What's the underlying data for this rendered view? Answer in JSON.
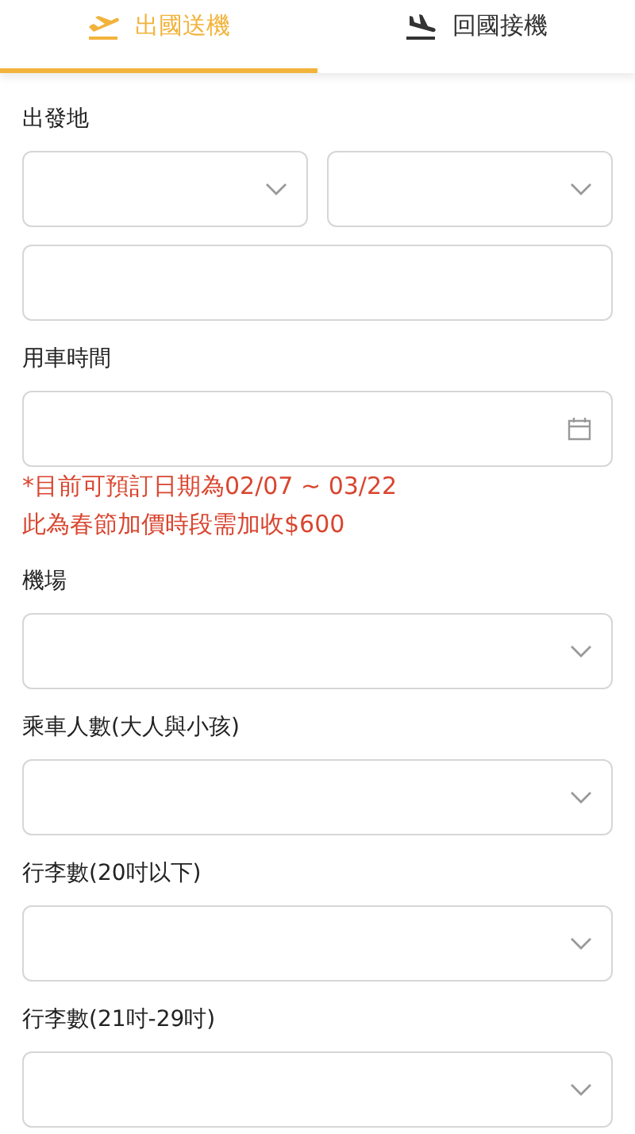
{
  "tabs": [
    {
      "label": "出國送機",
      "kind": "departure",
      "selected": true
    },
    {
      "label": "回國接機",
      "kind": "arrival",
      "selected": false
    }
  ],
  "form": [
    {
      "label": "出發地",
      "fields": [
        {
          "kind": "select"
        },
        {
          "kind": "select"
        }
      ]
    },
    {
      "fields": [
        {
          "kind": "text"
        }
      ]
    },
    {
      "label": "用車時間",
      "fields": [
        {
          "kind": "date"
        }
      ],
      "notes": [
        "*目前可預訂日期為02/07 ~ 03/22",
        "此為春節加價時段需加收$600"
      ]
    },
    {
      "label": "機場",
      "fields": [
        {
          "kind": "select"
        }
      ]
    },
    {
      "label": "乘車人數(大人與小孩)",
      "fields": [
        {
          "kind": "select"
        }
      ]
    },
    {
      "label": "行李數(20吋以下)",
      "fields": [
        {
          "kind": "select"
        }
      ]
    },
    {
      "label": "行李數(21吋-29吋)",
      "fields": [
        {
          "kind": "select"
        }
      ]
    }
  ]
}
